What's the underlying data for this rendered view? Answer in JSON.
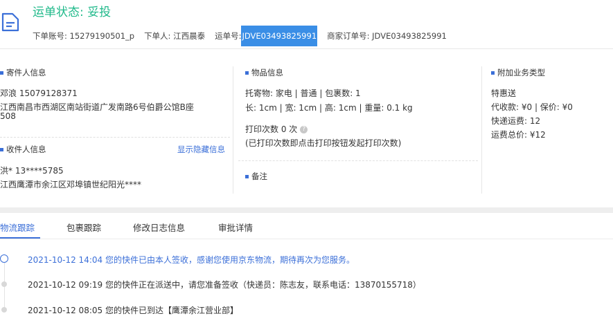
{
  "header": {
    "status_title": "运单状态: 妥投",
    "order_account_label": "下单账号: 15279190501_p",
    "orderer_label": "下单人: 江西晨泰",
    "waybill_label": "运单号:",
    "waybill_no": "JDVE03493825991",
    "merchant_order_label": "商家订单号: JDVE03493825991"
  },
  "sender": {
    "title": "寄件人信息",
    "name_phone": "邓浪   15079128371",
    "address_line1": "江西南昌市西湖区南站街道广发南路6号伯爵公馆B座",
    "address_line2": "508"
  },
  "receiver": {
    "title": "收件人信息",
    "show_hidden": "显示隐藏信息",
    "name_phone": "洪*   13****5785",
    "address": "江西鹰潭市余江区邓埠镇世纪阳光****"
  },
  "goods": {
    "title": "物品信息",
    "line1": "托寄物:  家电 | 普通  |  包裹数:  1",
    "line2": "长:  1cm  |  宽:  1cm  |  高:  1cm  |  重量:  0.1 kg",
    "print_count": "打印次数   0 次",
    "print_note": "(已打印次数即点击打印按钮发起打印次数)",
    "remark_title": "备注"
  },
  "extra": {
    "title": "附加业务类型",
    "line1": "特惠送",
    "line2": "代收款:  ¥0  |  保价:  ¥0",
    "line3": "快递运费:  12",
    "line4": "运费总价:  ¥12"
  },
  "tabs": [
    "物流跟踪",
    "包裹跟踪",
    "修改日志信息",
    "审批详情"
  ],
  "timeline": [
    "2021-10-12 14:04 您的快件已由本人签收，感谢您使用京东物流，期待再次为您服务。",
    "2021-10-12 09:19 您的快件正在派送中，请您准备签收（快递员：陈志友，联系电话：13870155718）",
    "2021-10-12 08:05 您的快件已到达【鹰潭余江营业部】"
  ],
  "colors": {
    "status_green": "#1fb98a",
    "accent_blue": "#3b6fd8",
    "highlight_blue": "#3a8ee6"
  }
}
